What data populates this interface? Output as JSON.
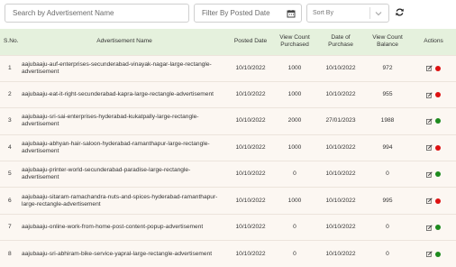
{
  "filters": {
    "search_placeholder": "Search by Advertisement Name",
    "date_placeholder": "Filter By Posted Date",
    "sort_label": "Sort By"
  },
  "table": {
    "headers": {
      "sno": "S.No.",
      "name": "Advertisement Name",
      "posted": "Posted Date",
      "view_count_purchased": "View Count Purchased",
      "date_of_purchase": "Date of Purchase",
      "view_count_balance": "View Count Balance",
      "actions": "Actions"
    },
    "rows": [
      {
        "sno": "1",
        "name": "aajubaaju-auf-enterprises-secunderabad-vinayak-nagar-large-rectangle-advertisement",
        "posted": "10/10/2022",
        "purchased": "1000",
        "purchase_date": "10/10/2022",
        "balance": "972",
        "status_color": "#dd1111"
      },
      {
        "sno": "2",
        "name": "aajubaaju-eat-it-right-secunderabad-kapra-large-rectangle-advertisement",
        "posted": "10/10/2022",
        "purchased": "1000",
        "purchase_date": "10/10/2022",
        "balance": "955",
        "status_color": "#dd1111"
      },
      {
        "sno": "3",
        "name": "aajubaaju-sri-sai-enterprises-hyderabad-kukatpally-large-rectangle-advertisement",
        "posted": "10/10/2022",
        "purchased": "2000",
        "purchase_date": "27/01/2023",
        "balance": "1988",
        "status_color": "#1e8a1e"
      },
      {
        "sno": "4",
        "name": "aajubaaju-abhyan-hair-saloon-hyderabad-ramanthapur-large-rectangle-advertisement",
        "posted": "10/10/2022",
        "purchased": "1000",
        "purchase_date": "10/10/2022",
        "balance": "994",
        "status_color": "#dd1111"
      },
      {
        "sno": "5",
        "name": "aajubaaju-printer-world-secunderabad-paradise-large-rectangle-advertisement",
        "posted": "10/10/2022",
        "purchased": "0",
        "purchase_date": "10/10/2022",
        "balance": "0",
        "status_color": "#1e8a1e"
      },
      {
        "sno": "6",
        "name": "aajubaaju-sitaram-ramachandra-nuts-and-spices-hyderabad-ramanthapur-large-rectangle-advertisement",
        "posted": "10/10/2022",
        "purchased": "1000",
        "purchase_date": "10/10/2022",
        "balance": "995",
        "status_color": "#dd1111"
      },
      {
        "sno": "7",
        "name": "aajubaaju-online-work-from-home-post-content-popup-advertisement",
        "posted": "10/10/2022",
        "purchased": "0",
        "purchase_date": "10/10/2022",
        "balance": "0",
        "status_color": "#1e8a1e"
      },
      {
        "sno": "8",
        "name": "aajubaaju-sri-abhiram-bike-service-yapral-large-rectangle-advertisement",
        "posted": "10/10/2022",
        "purchased": "0",
        "purchase_date": "10/10/2022",
        "balance": "0",
        "status_color": "#1e8a1e"
      }
    ]
  },
  "icons": {
    "calendar": "calendar-icon",
    "chevron": "chevron-down-icon",
    "refresh": "refresh-icon",
    "edit": "edit-icon",
    "status": "status-dot-icon"
  }
}
